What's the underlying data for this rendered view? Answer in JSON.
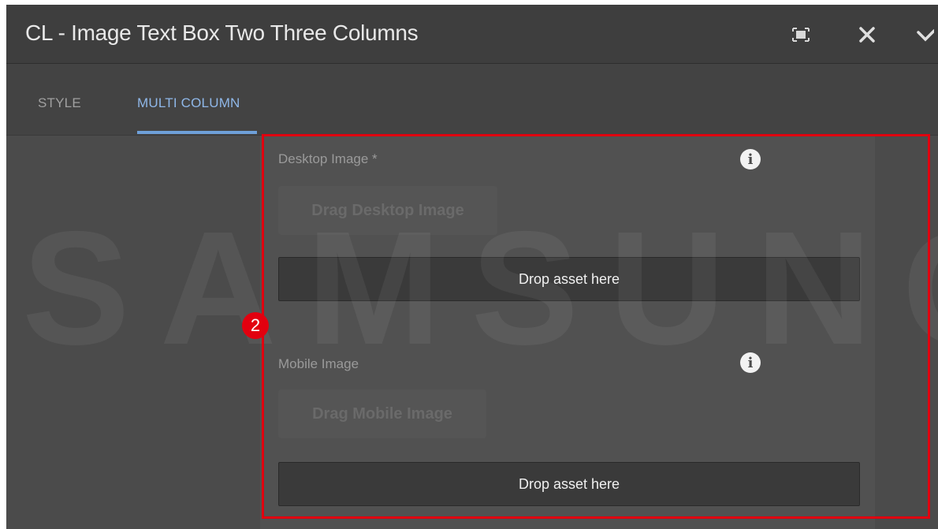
{
  "dialog": {
    "title": "CL - Image Text Box Two Three Columns",
    "actions": {
      "fullscreen_icon": "fullscreen-icon",
      "close_icon": "close-icon",
      "done_icon": "check-icon"
    }
  },
  "tabs": [
    {
      "label": "STYLE",
      "active": false
    },
    {
      "label": "MULTI COLUMN",
      "active": true
    }
  ],
  "fields": {
    "desktop": {
      "label": "Desktop Image *",
      "drag_label": "Drag Desktop Image",
      "drop_label": "Drop asset here",
      "info_icon": "info-icon"
    },
    "mobile": {
      "label": "Mobile Image",
      "drag_label": "Drag Mobile Image",
      "drop_label": "Drop asset here",
      "info_icon": "info-icon"
    }
  },
  "annotation": {
    "step": "2",
    "color": "#e2000f"
  },
  "watermark": "SAMSUNG",
  "colors": {
    "accent": "#6ea0d9",
    "background": "#4b4b4b",
    "highlight": "#e0000f"
  }
}
